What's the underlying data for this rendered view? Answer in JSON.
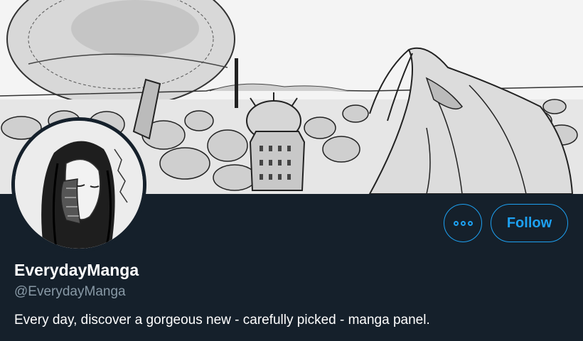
{
  "profile": {
    "display_name": "EverydayManga",
    "handle": "@EverydayManga",
    "bio": "Every day, discover a gorgeous new - carefully picked - manga panel."
  },
  "actions": {
    "more_icon": "more-dots-icon",
    "follow_label": "Follow"
  },
  "colors": {
    "accent": "#1da1f2",
    "background": "#15202b",
    "secondary_text": "#8899a6"
  }
}
